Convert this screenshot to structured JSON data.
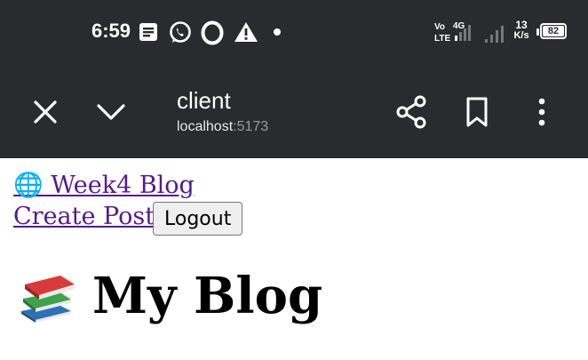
{
  "status_bar": {
    "time": "6:59",
    "network": "4G",
    "speed_value": "13",
    "speed_unit": "K/s",
    "battery": "82",
    "icons": [
      "notes-icon",
      "whatsapp-icon",
      "opera-icon",
      "warning-icon",
      "dot-icon",
      "volte-icon",
      "signal-icon",
      "battery-icon"
    ]
  },
  "toolbar": {
    "title": "client",
    "url_host": "localhost",
    "url_port": ":5173",
    "icons": [
      "close-icon",
      "chevron-down-icon",
      "share-icon",
      "bookmark-icon",
      "more-icon"
    ]
  },
  "page": {
    "home_link": "🌐 Week4 Blog",
    "create_link": "Create Post",
    "logout_label": "Logout",
    "heading": "My Blog",
    "heading_icon": "books-icon",
    "colors": {
      "link": "#551a8b",
      "bar": "#2a2b2e"
    }
  }
}
